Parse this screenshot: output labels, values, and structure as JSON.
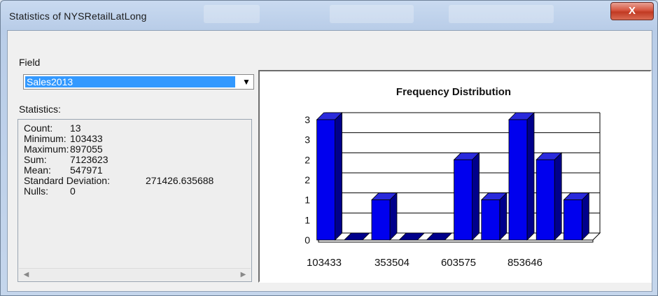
{
  "window": {
    "title": "Statistics of NYSRetailLatLong",
    "close_glyph": "X"
  },
  "field": {
    "label": "Field",
    "selected": "Sales2013",
    "arrow_icon": "chevron-down-icon"
  },
  "statistics": {
    "label": "Statistics:",
    "rows": [
      {
        "label": "Count:",
        "value": "13"
      },
      {
        "label": "Minimum:",
        "value": "103433"
      },
      {
        "label": "Maximum:",
        "value": "897055"
      },
      {
        "label": "Sum:",
        "value": "7123623"
      },
      {
        "label": "Mean:",
        "value": "547971"
      },
      {
        "label": "Standard Deviation:",
        "value": "271426.635688"
      },
      {
        "label": "Nulls:",
        "value": "0"
      }
    ]
  },
  "chart_data": {
    "type": "bar",
    "title": "Frequency Distribution",
    "xlabel": "",
    "ylabel": "",
    "x_tick_labels": [
      "103433",
      "353504",
      "603575",
      "853646"
    ],
    "y_tick_labels": [
      "0",
      "1",
      "1",
      "2",
      "2",
      "3",
      "3"
    ],
    "values": [
      3,
      0,
      1,
      0,
      0,
      2,
      1,
      3,
      2,
      1
    ],
    "ylim": [
      0,
      3
    ],
    "bar_color": "#0000ee",
    "bar_side_color": "#00008b",
    "grid": true,
    "style": "3d"
  }
}
